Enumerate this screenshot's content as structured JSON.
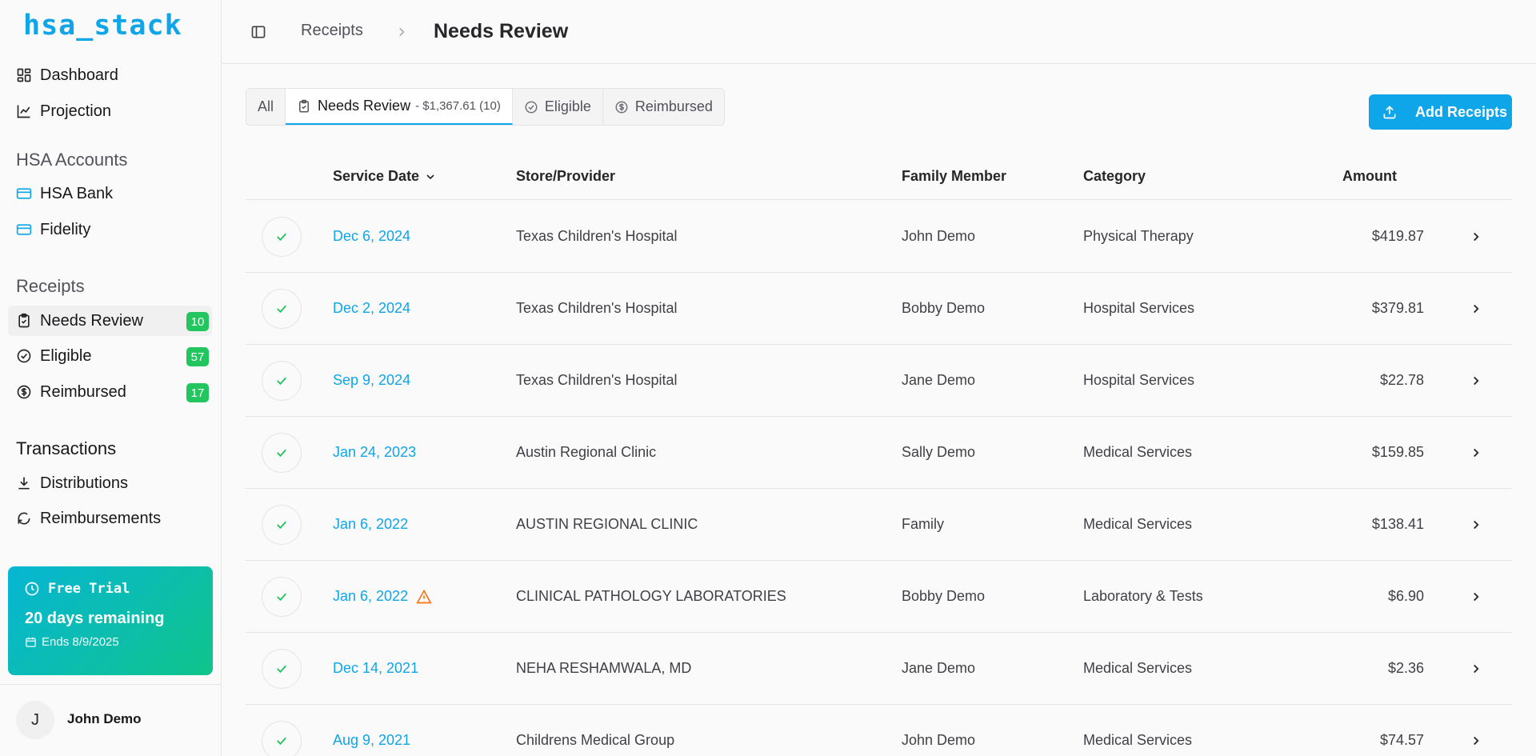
{
  "brand": "hsa_stack",
  "sidebar": {
    "top_items": [
      {
        "label": "Dashboard",
        "icon": "dashboard-icon"
      },
      {
        "label": "Projection",
        "icon": "chart-line-icon"
      }
    ],
    "accounts_label": "HSA Accounts",
    "accounts": [
      {
        "label": "HSA Bank",
        "icon": "credit-card-icon"
      },
      {
        "label": "Fidelity",
        "icon": "credit-card-icon"
      }
    ],
    "receipts_label": "Receipts",
    "receipts": [
      {
        "label": "Needs Review",
        "badge": "10",
        "icon": "clipboard-check-icon",
        "active": true
      },
      {
        "label": "Eligible",
        "badge": "57",
        "icon": "check-circle-icon"
      },
      {
        "label": "Reimbursed",
        "badge": "17",
        "icon": "dollar-circle-icon"
      }
    ],
    "transactions_label": "Transactions",
    "transactions": [
      {
        "label": "Distributions",
        "icon": "download-icon"
      },
      {
        "label": "Reimbursements",
        "icon": "refresh-icon"
      }
    ],
    "trial": {
      "title": "Free Trial",
      "days": "20 days remaining",
      "ends": "Ends 8/9/2025"
    },
    "user": {
      "initial": "J",
      "name": "John Demo"
    }
  },
  "header": {
    "breadcrumb": "Receipts",
    "title": "Needs Review"
  },
  "tabs": [
    {
      "label": "All"
    },
    {
      "label": "Needs Review",
      "sub": "- $1,367.61 (10)"
    },
    {
      "label": "Eligible"
    },
    {
      "label": "Reimbursed"
    }
  ],
  "add_button": "Add Receipts",
  "table": {
    "columns": [
      "Service Date",
      "Store/Provider",
      "Family Member",
      "Category",
      "Amount"
    ],
    "rows": [
      {
        "date": "Dec 6, 2024",
        "provider": "Texas Children's Hospital",
        "member": "John Demo",
        "category": "Physical Therapy",
        "amount": "$419.87",
        "warning": false
      },
      {
        "date": "Dec 2, 2024",
        "provider": "Texas Children's Hospital",
        "member": "Bobby Demo",
        "category": "Hospital Services",
        "amount": "$379.81",
        "warning": false
      },
      {
        "date": "Sep 9, 2024",
        "provider": "Texas Children's Hospital",
        "member": "Jane Demo",
        "category": "Hospital Services",
        "amount": "$22.78",
        "warning": false
      },
      {
        "date": "Jan 24, 2023",
        "provider": "Austin Regional Clinic",
        "member": "Sally Demo",
        "category": "Medical Services",
        "amount": "$159.85",
        "warning": false
      },
      {
        "date": "Jan 6, 2022",
        "provider": "AUSTIN REGIONAL CLINIC",
        "member": "Family",
        "category": "Medical Services",
        "amount": "$138.41",
        "warning": false
      },
      {
        "date": "Jan 6, 2022",
        "provider": "CLINICAL PATHOLOGY LABORATORIES",
        "member": "Bobby Demo",
        "category": "Laboratory & Tests",
        "amount": "$6.90",
        "warning": true
      },
      {
        "date": "Dec 14, 2021",
        "provider": "NEHA RESHAMWALA, MD",
        "member": "Jane Demo",
        "category": "Medical Services",
        "amount": "$2.36",
        "warning": false
      },
      {
        "date": "Aug 9, 2021",
        "provider": "Childrens Medical Group",
        "member": "John Demo",
        "category": "Medical Services",
        "amount": "$74.57",
        "warning": false
      }
    ]
  },
  "colors": {
    "accent": "#0ea5e9",
    "badge": "#22c55e",
    "warning": "#f97316"
  }
}
